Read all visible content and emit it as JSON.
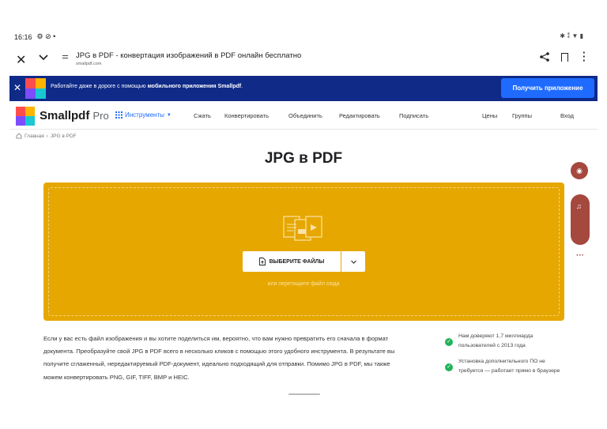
{
  "status": {
    "time": "16:16",
    "left_icons": "⚙ ⊘ •",
    "right_icons": "✱ ⁑ ▼ ▮"
  },
  "tabbar": {
    "title": "JPG в PDF - конвертация изображений в PDF онлайн бесплатно",
    "url": "smallpdf.com"
  },
  "promo": {
    "text_plain": "Работайте даже в дороге с помощью ",
    "text_bold": "мобильного приложения Smallpdf",
    "text_end": ".",
    "button": "Получить приложение"
  },
  "nav": {
    "brand": "Smallpdf",
    "brand_suffix": "Pro",
    "tools": "Инструменты",
    "items": [
      "Сжать",
      "Конвертировать",
      "Объединить",
      "Редактировать",
      "Подписать"
    ],
    "right_items": [
      "Цены",
      "Группы",
      "Вход"
    ]
  },
  "breadcrumb": {
    "home": "Главная",
    "separator": "›",
    "current": "JPG в PDF"
  },
  "page_title": "JPG в PDF",
  "drop": {
    "button": "ВЫБЕРИТЕ ФАЙЛЫ",
    "hint": "или перетащите файл сюда"
  },
  "description": "Если у вас есть файл изображения и вы хотите поделиться им, вероятно, что вам нужно превратить его сначала в формат документа. Преобразуйте свой JPG в PDF всего в несколько кликов с помощью этого удобного инструмента. В результате вы получите сглаженный, нередактируемый PDF-документ, идеально подходящий для отправки. Помимо JPG в PDF, мы также можем конвертировать PNG, GIF, TIFF, BMP и HEIC.",
  "trust": [
    "Нам доверяют 1,7 миллиарда пользователей с 2013 года",
    "Установка дополнительного ПО не требуется — работает прямо в браузере"
  ],
  "colors": {
    "banner": "#0f2a87",
    "accent": "#1f6bff",
    "drop_zone": "#e6a700",
    "float": "#a5483e",
    "check": "#22b35a"
  },
  "icons": [
    "close-icon",
    "chevron-down-icon",
    "tune-icon",
    "share-icon",
    "bookmark-icon",
    "more-vert-icon",
    "grid-icon",
    "home-icon",
    "upload-file-icon",
    "check-icon"
  ]
}
